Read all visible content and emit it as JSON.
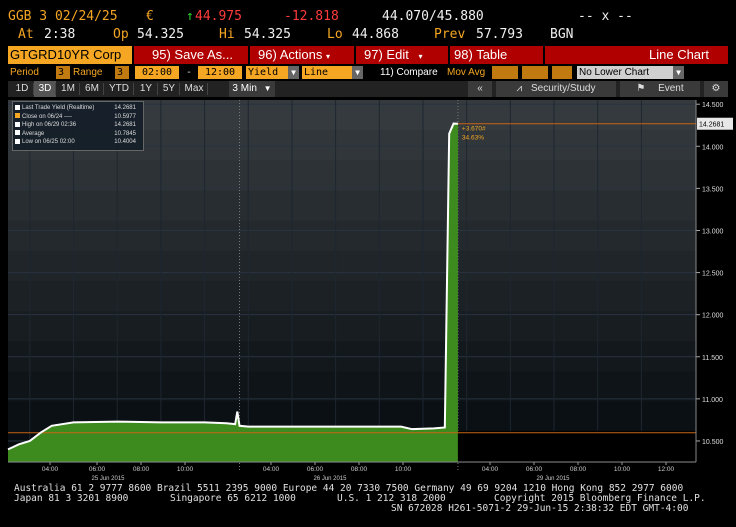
{
  "quote": {
    "ticker": "GGB 3 02/24/25",
    "currency": "€",
    "arrow": "↑",
    "last": "44.975",
    "change": "-12.818",
    "bid_ask": "44.070/45.880",
    "dashes": "-- x --",
    "at_label": "At",
    "at_time": "2:38",
    "open_label": "Op",
    "open": "54.325",
    "high_label": "Hi",
    "high": "54.325",
    "low_label": "Lo",
    "low": "44.868",
    "prev_label": "Prev",
    "prev": "57.793",
    "source": "BGN"
  },
  "toolbar": {
    "security": "GTGRD10YR Corp",
    "save_key": "95)",
    "save_label": "Save As...",
    "actions_key": "96)",
    "actions_label": "Actions",
    "edit_key": "97)",
    "edit_label": "Edit",
    "table_key": "98)",
    "table_label": "Table",
    "chart_type": "Line Chart"
  },
  "options": {
    "period_label": "Period",
    "period_value": "3",
    "range_label": "Range",
    "range_value": "3",
    "start_time": "02:00",
    "dash": "-",
    "end_time": "12:00",
    "field": "Yield",
    "style": "Line",
    "compare_key": "11)",
    "compare_label": "Compare",
    "mov_avg_label": "Mov Avg",
    "lower_chart": "No Lower Chart"
  },
  "periods": [
    "1D",
    "3D",
    "1M",
    "6M",
    "YTD",
    "1Y",
    "5Y",
    "Max"
  ],
  "selected_period": "3D",
  "interval": "3 Min",
  "right_controls": {
    "collapse": "«",
    "security_study": "Security/Study",
    "event": "Event"
  },
  "legend": [
    {
      "label": "Last Trade Yield (Realtime)",
      "value": "14.2681",
      "color": "#ffffff"
    },
    {
      "label": "Close on 06/24",
      "value": "10.5977",
      "color": "#f5a623"
    },
    {
      "label": "High on 06/29 02:36",
      "value": "14.2681",
      "color": "#ffffff"
    },
    {
      "label": "Average",
      "value": "10.7845",
      "color": "#ffffff"
    },
    {
      "label": "Low on 06/25 02:00",
      "value": "10.4004",
      "color": "#ffffff"
    }
  ],
  "legend_dash": "----",
  "chart_data": {
    "type": "area",
    "title": "",
    "ylim": [
      10.25,
      14.55
    ],
    "y_ticks": [
      "14.500",
      "14.000",
      "13.500",
      "13.000",
      "12.500",
      "12.000",
      "11.500",
      "11.000",
      "10.500"
    ],
    "x_tick_labels": [
      "04:00",
      "06:00",
      "08:00",
      "10:00",
      "04:00",
      "06:00",
      "08:00",
      "10:00",
      "04:00",
      "06:00",
      "08:00",
      "10:00",
      "12:00"
    ],
    "day_labels": [
      "25 Jun 2015",
      "26 Jun 2015",
      "29 Jun 2015"
    ],
    "last_value_label": "14.2681",
    "change_annotation": "+3.670#",
    "pct_annotation": "34.63%",
    "close_level": 10.5977,
    "line_color": "#ffffff",
    "fill_color": "#3d8a1e",
    "series": [
      {
        "name": "Last Trade Yield (Realtime)",
        "points": [
          [
            0,
            10.4
          ],
          [
            0.5,
            10.46
          ],
          [
            1,
            10.5
          ],
          [
            1.5,
            10.6
          ],
          [
            2,
            10.68
          ],
          [
            3,
            10.72
          ],
          [
            5,
            10.73
          ],
          [
            7,
            10.72
          ],
          [
            9,
            10.72
          ],
          [
            10,
            10.71
          ],
          [
            10.4,
            10.7
          ],
          [
            10.5,
            10.85
          ],
          [
            10.6,
            10.68
          ],
          [
            11,
            10.67
          ],
          [
            14,
            10.67
          ],
          [
            18,
            10.67
          ],
          [
            18.5,
            10.64
          ],
          [
            19.5,
            10.65
          ],
          [
            20,
            10.66
          ],
          [
            20.2,
            14.15
          ],
          [
            20.4,
            14.27
          ],
          [
            20.6,
            14.268
          ]
        ]
      }
    ]
  },
  "footer": {
    "line1": "Australia 61 2 9777 8600 Brazil 5511 2395 9000 Europe 44 20 7330 7500 Germany 49 69 9204 1210 Hong Kong 852 2977 6000",
    "line2_left": "Japan 81 3 3201 8900",
    "line2_mid": "Singapore 65 6212 1000",
    "line2_us": "U.S. 1 212 318 2000",
    "line2_right": "Copyright 2015 Bloomberg Finance L.P.",
    "line3": "SN 672028 H261-5071-2 29-Jun-15  2:38:32 EDT  GMT-4:00"
  }
}
